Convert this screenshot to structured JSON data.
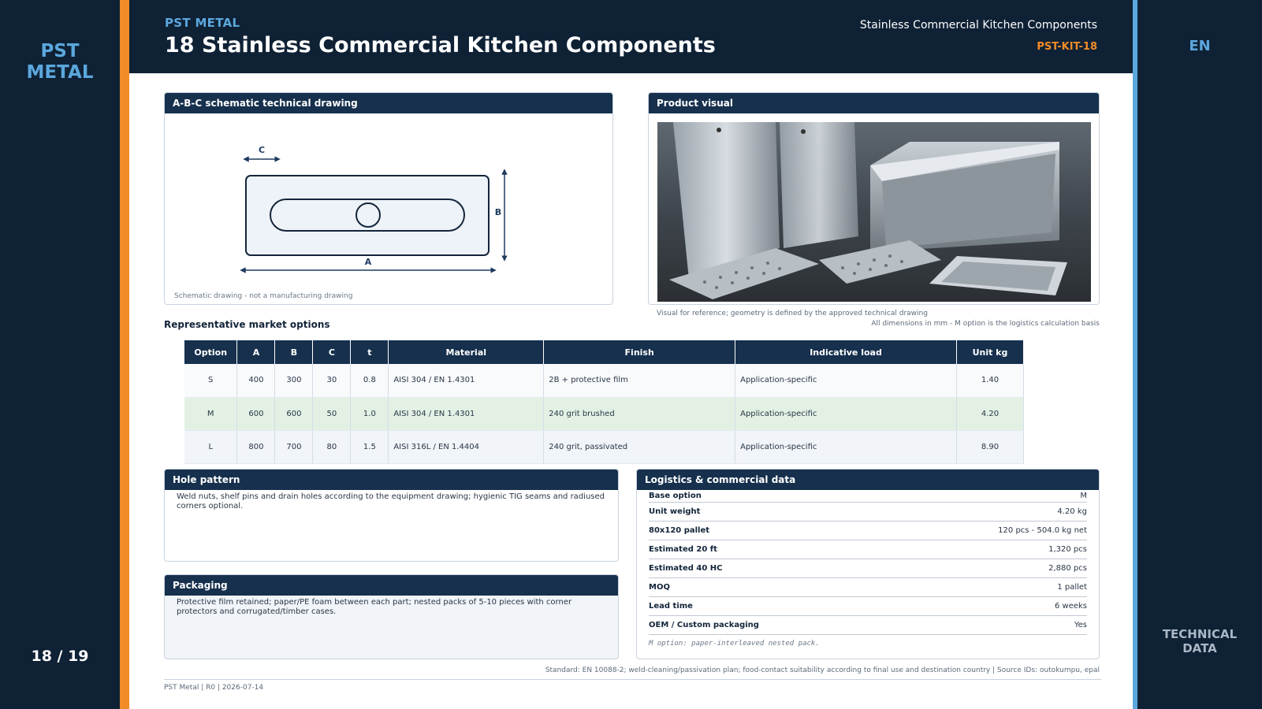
{
  "brand": {
    "logo_line1": "PST",
    "logo_line2": "METAL",
    "small_label": "PST METAL"
  },
  "page": {
    "counter": "18 / 19",
    "language": "EN",
    "section_line1": "TECHNICAL",
    "section_line2": "DATA"
  },
  "header": {
    "title": "18  Stainless Commercial Kitchen Components",
    "right_title": "Stainless Commercial Kitchen Components",
    "code": "PST-KIT-18"
  },
  "drawing": {
    "heading": "A-B-C schematic technical drawing",
    "label_a": "A",
    "label_b": "B",
    "label_c": "C",
    "note": "Schematic drawing - not a manufacturing drawing"
  },
  "visual": {
    "heading": "Product visual",
    "note": "Visual for reference; geometry is defined by the approved technical drawing"
  },
  "dims_note": "All dimensions in mm - M option is the logistics calculation basis",
  "options": {
    "title": "Representative market options",
    "headers": [
      "Option",
      "A",
      "B",
      "C",
      "t",
      "Material",
      "Finish",
      "Indicative load",
      "Unit kg"
    ],
    "rows": [
      [
        "S",
        "400",
        "300",
        "30",
        "0.8",
        "AISI 304 / EN 1.4301",
        "2B + protective film",
        "Application-specific",
        "1.40"
      ],
      [
        "M",
        "600",
        "600",
        "50",
        "1.0",
        "AISI 304 / EN 1.4301",
        "240 grit brushed",
        "Application-specific",
        "4.20"
      ],
      [
        "L",
        "800",
        "700",
        "80",
        "1.5",
        "AISI 316L / EN 1.4404",
        "240 grit, passivated",
        "Application-specific",
        "8.90"
      ]
    ]
  },
  "hole_pattern": {
    "heading": "Hole pattern",
    "text": "Weld nuts, shelf pins and drain holes according to the equipment drawing; hygienic TIG seams and radiused corners optional."
  },
  "packaging": {
    "heading": "Packaging",
    "text": "Protective film retained; paper/PE foam between each part; nested packs of 5-10 pieces with corner protectors and corrugated/timber cases."
  },
  "logistics": {
    "heading": "Logistics & commercial data",
    "rows": [
      {
        "key": "Base option",
        "value": "M"
      },
      {
        "key": "Unit weight",
        "value": "4.20 kg"
      },
      {
        "key": "80x120 pallet",
        "value": "120 pcs - 504.0 kg net"
      },
      {
        "key": "Estimated 20 ft",
        "value": "1,320 pcs"
      },
      {
        "key": "Estimated 40 HC",
        "value": "2,880 pcs"
      },
      {
        "key": "MOQ",
        "value": "1 pallet"
      },
      {
        "key": "Lead time",
        "value": "6 weeks"
      },
      {
        "key": "OEM / Custom packaging",
        "value": "Yes"
      }
    ],
    "note": "M option: paper-interleaved nested pack."
  },
  "standard": "Standard: EN 10088-2; weld-cleaning/passivation plan; food-contact suitability according to final use and destination country | Source IDs: outokumpu, epal",
  "footer": "PST Metal | R0 | 2026-07-14",
  "colors": {
    "navy": "#0f2135",
    "header_blue": "#16304d",
    "accent_orange": "#f28c28",
    "accent_blue": "#5ba7dd",
    "highlight_green": "#e3f1e5"
  }
}
